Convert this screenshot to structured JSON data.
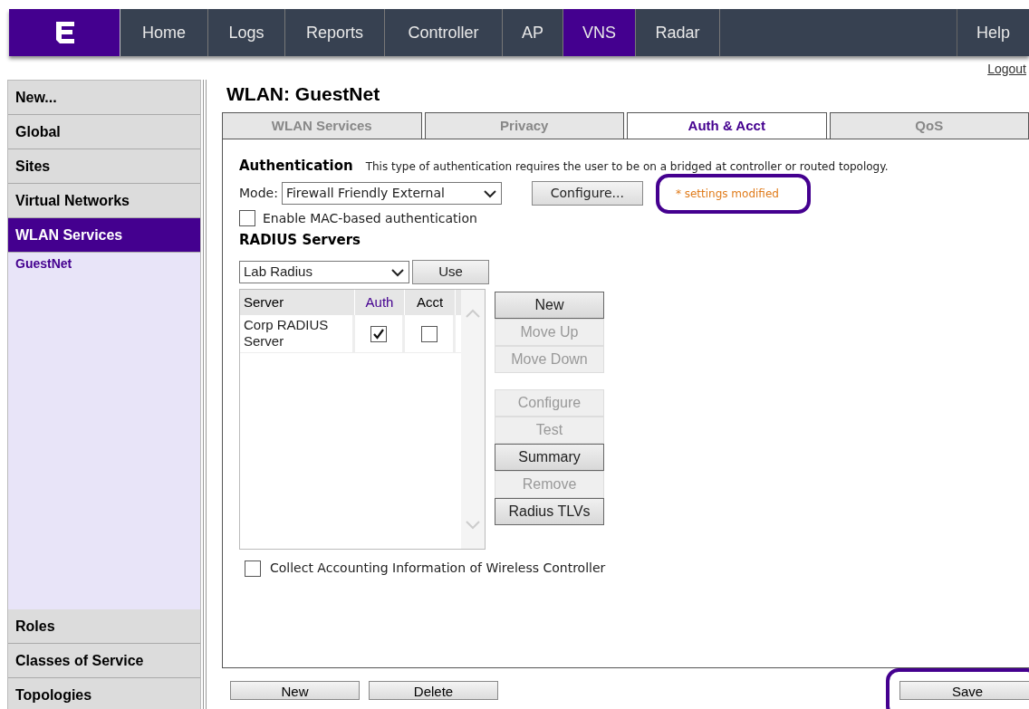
{
  "nav": {
    "items": [
      {
        "label": "Home",
        "selected": false
      },
      {
        "label": "Logs",
        "selected": false
      },
      {
        "label": "Reports",
        "selected": false
      },
      {
        "label": "Controller",
        "selected": false
      },
      {
        "label": "AP",
        "selected": false
      },
      {
        "label": "VNS",
        "selected": true
      },
      {
        "label": "Radar",
        "selected": false
      }
    ],
    "help": "Help",
    "logout": "Logout"
  },
  "sidebar": {
    "items": [
      {
        "label": "New...",
        "selected": false
      },
      {
        "label": "Global",
        "selected": false
      },
      {
        "label": "Sites",
        "selected": false
      },
      {
        "label": "Virtual Networks",
        "selected": false
      },
      {
        "label": "WLAN Services",
        "selected": true,
        "children": [
          {
            "label": "GuestNet",
            "selected": true
          }
        ]
      }
    ],
    "bottom_items": [
      {
        "label": "Roles",
        "selected": false
      },
      {
        "label": "Classes of Service",
        "selected": false
      },
      {
        "label": "Topologies",
        "selected": false
      }
    ]
  },
  "title": "WLAN: GuestNet",
  "tabs": [
    {
      "label": "WLAN Services",
      "selected": false
    },
    {
      "label": "Privacy",
      "selected": false
    },
    {
      "label": "Auth & Acct",
      "selected": true
    },
    {
      "label": "QoS",
      "selected": false
    }
  ],
  "authentication": {
    "heading": "Authentication",
    "note": "This type of authentication requires the user to be on a bridged at controller or routed topology.",
    "mode_label": "Mode:",
    "mode_value": "Firewall Friendly External",
    "configure_button": "Configure...",
    "modified_note": "* settings modified",
    "modified_highlighted": true,
    "mac_auth": {
      "label": "Enable MAC-based authentication",
      "checked": false
    }
  },
  "radius": {
    "heading": "RADIUS Servers",
    "server_select": "Lab Radius",
    "use_button": "Use",
    "columns": [
      {
        "label": "Server",
        "highlighted": false
      },
      {
        "label": "Auth",
        "highlighted": true
      },
      {
        "label": "Acct",
        "highlighted": false
      }
    ],
    "rows": [
      {
        "server": "Corp RADIUS Server",
        "auth": true,
        "acct": false
      }
    ],
    "button_groups": [
      [
        {
          "label": "New",
          "disabled": false
        },
        {
          "label": "Move Up",
          "disabled": true
        },
        {
          "label": "Move Down",
          "disabled": true
        }
      ],
      [
        {
          "label": "Configure",
          "disabled": true
        },
        {
          "label": "Test",
          "disabled": true
        },
        {
          "label": "Summary",
          "disabled": false
        },
        {
          "label": "Remove",
          "disabled": true
        },
        {
          "label": "Radius TLVs",
          "disabled": false
        }
      ]
    ]
  },
  "collect_accounting": {
    "label": "Collect Accounting Information of Wireless Controller",
    "checked": false
  },
  "footer": {
    "buttons": [
      {
        "label": "New",
        "highlighted": false
      },
      {
        "label": "Delete",
        "highlighted": false
      }
    ],
    "save": {
      "label": "Save",
      "highlighted": true
    }
  }
}
